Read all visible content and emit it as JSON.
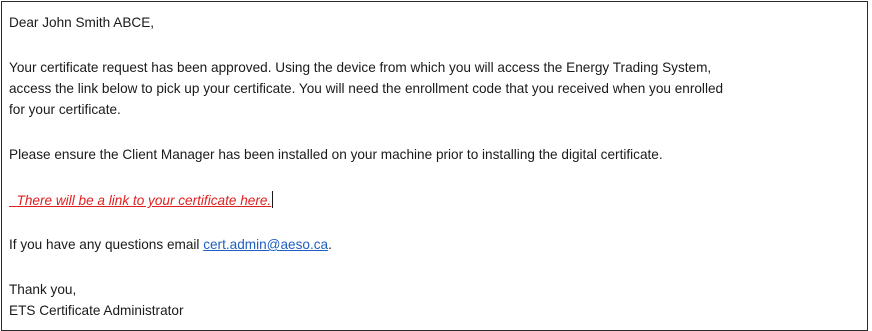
{
  "letter": {
    "salutation": "Dear John Smith ABCE,",
    "body_line_1": "Your certificate request has been approved. Using the device from which you will access the Energy Trading System,",
    "body_line_2": "access the link below to pick up your certificate. You will need the enrollment code that you received when you enrolled",
    "body_line_3": "for your certificate.",
    "client_manager_note": "Please ensure the Client Manager has been installed on your machine prior to installing the digital certificate.",
    "placeholder_text": "There will be a link to your certificate here.",
    "questions_prefix": "If you have any questions email ",
    "contact_email": "cert.admin@aeso.ca",
    "questions_suffix": ".",
    "closing": "Thank you,",
    "signature": "ETS Certificate Administrator"
  },
  "colors": {
    "placeholder": "#e02020",
    "link": "#1f5fbf",
    "text": "#1a1a1a",
    "border": "#2b2b2b"
  }
}
